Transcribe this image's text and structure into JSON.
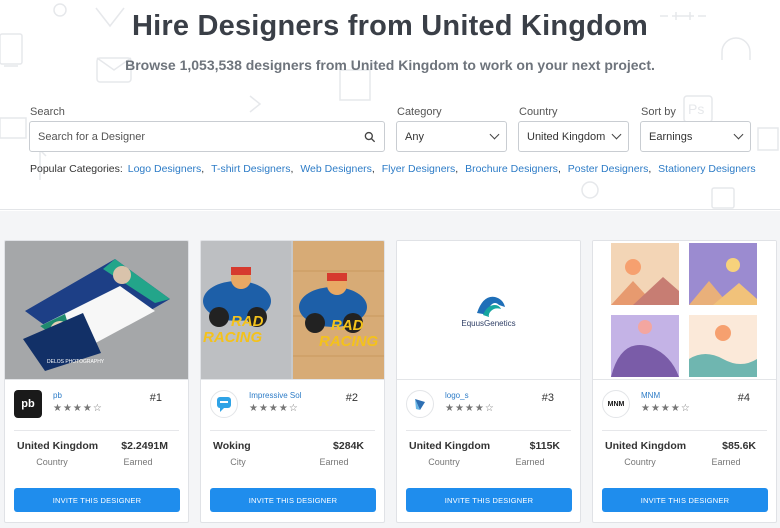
{
  "header": {
    "title": "Hire Designers from United Kingdom",
    "subtitle": "Browse 1,053,538 designers from United Kingdom to work on your next project."
  },
  "filters": {
    "search": {
      "label": "Search",
      "placeholder": "Search for a Designer"
    },
    "category": {
      "label": "Category",
      "value": "Any"
    },
    "country": {
      "label": "Country",
      "value": "United Kingdom"
    },
    "sort": {
      "label": "Sort by",
      "value": "Earnings"
    }
  },
  "popular": {
    "label": "Popular Categories:",
    "items": [
      "Logo Designers",
      "T-shirt Designers",
      "Web Designers",
      "Flyer Designers",
      "Brochure Designers",
      "Poster Designers",
      "Stationery Designers"
    ]
  },
  "icons": {
    "search": "search-icon",
    "dropdown": "chevron-down-icon",
    "star": "star-icon"
  },
  "colors": {
    "accent": "#1f8ded",
    "link": "#2d7cc7",
    "title": "#3a3f47"
  },
  "designers": [
    {
      "name": "pb",
      "avatar_text": "pb",
      "rank": "#1",
      "stars": "★★★★☆",
      "location": "United Kingdom",
      "location_label": "Country",
      "earned": "$2.2491M",
      "earned_label": "Earned",
      "button": "INVITE THIS DESIGNER"
    },
    {
      "name": "Impressive Sol",
      "avatar_text": "",
      "rank": "#2",
      "stars": "★★★★☆",
      "location": "Woking",
      "location_label": "City",
      "earned": "$284K",
      "earned_label": "Earned",
      "button": "INVITE THIS DESIGNER",
      "thumb_text_1": "RAD",
      "thumb_text_2": "RACING"
    },
    {
      "name": "logo_s",
      "avatar_text": "",
      "rank": "#3",
      "stars": "★★★★☆",
      "location": "United Kingdom",
      "location_label": "Country",
      "earned": "$115K",
      "earned_label": "Earned",
      "button": "INVITE THIS DESIGNER",
      "thumb_text": "EquusGenetics"
    },
    {
      "name": "MNM",
      "avatar_text": "MNM",
      "rank": "#4",
      "stars": "★★★★☆",
      "location": "United Kingdom",
      "location_label": "Country",
      "earned": "$85.6K",
      "earned_label": "Earned",
      "button": "INVITE THIS DESIGNER"
    }
  ]
}
